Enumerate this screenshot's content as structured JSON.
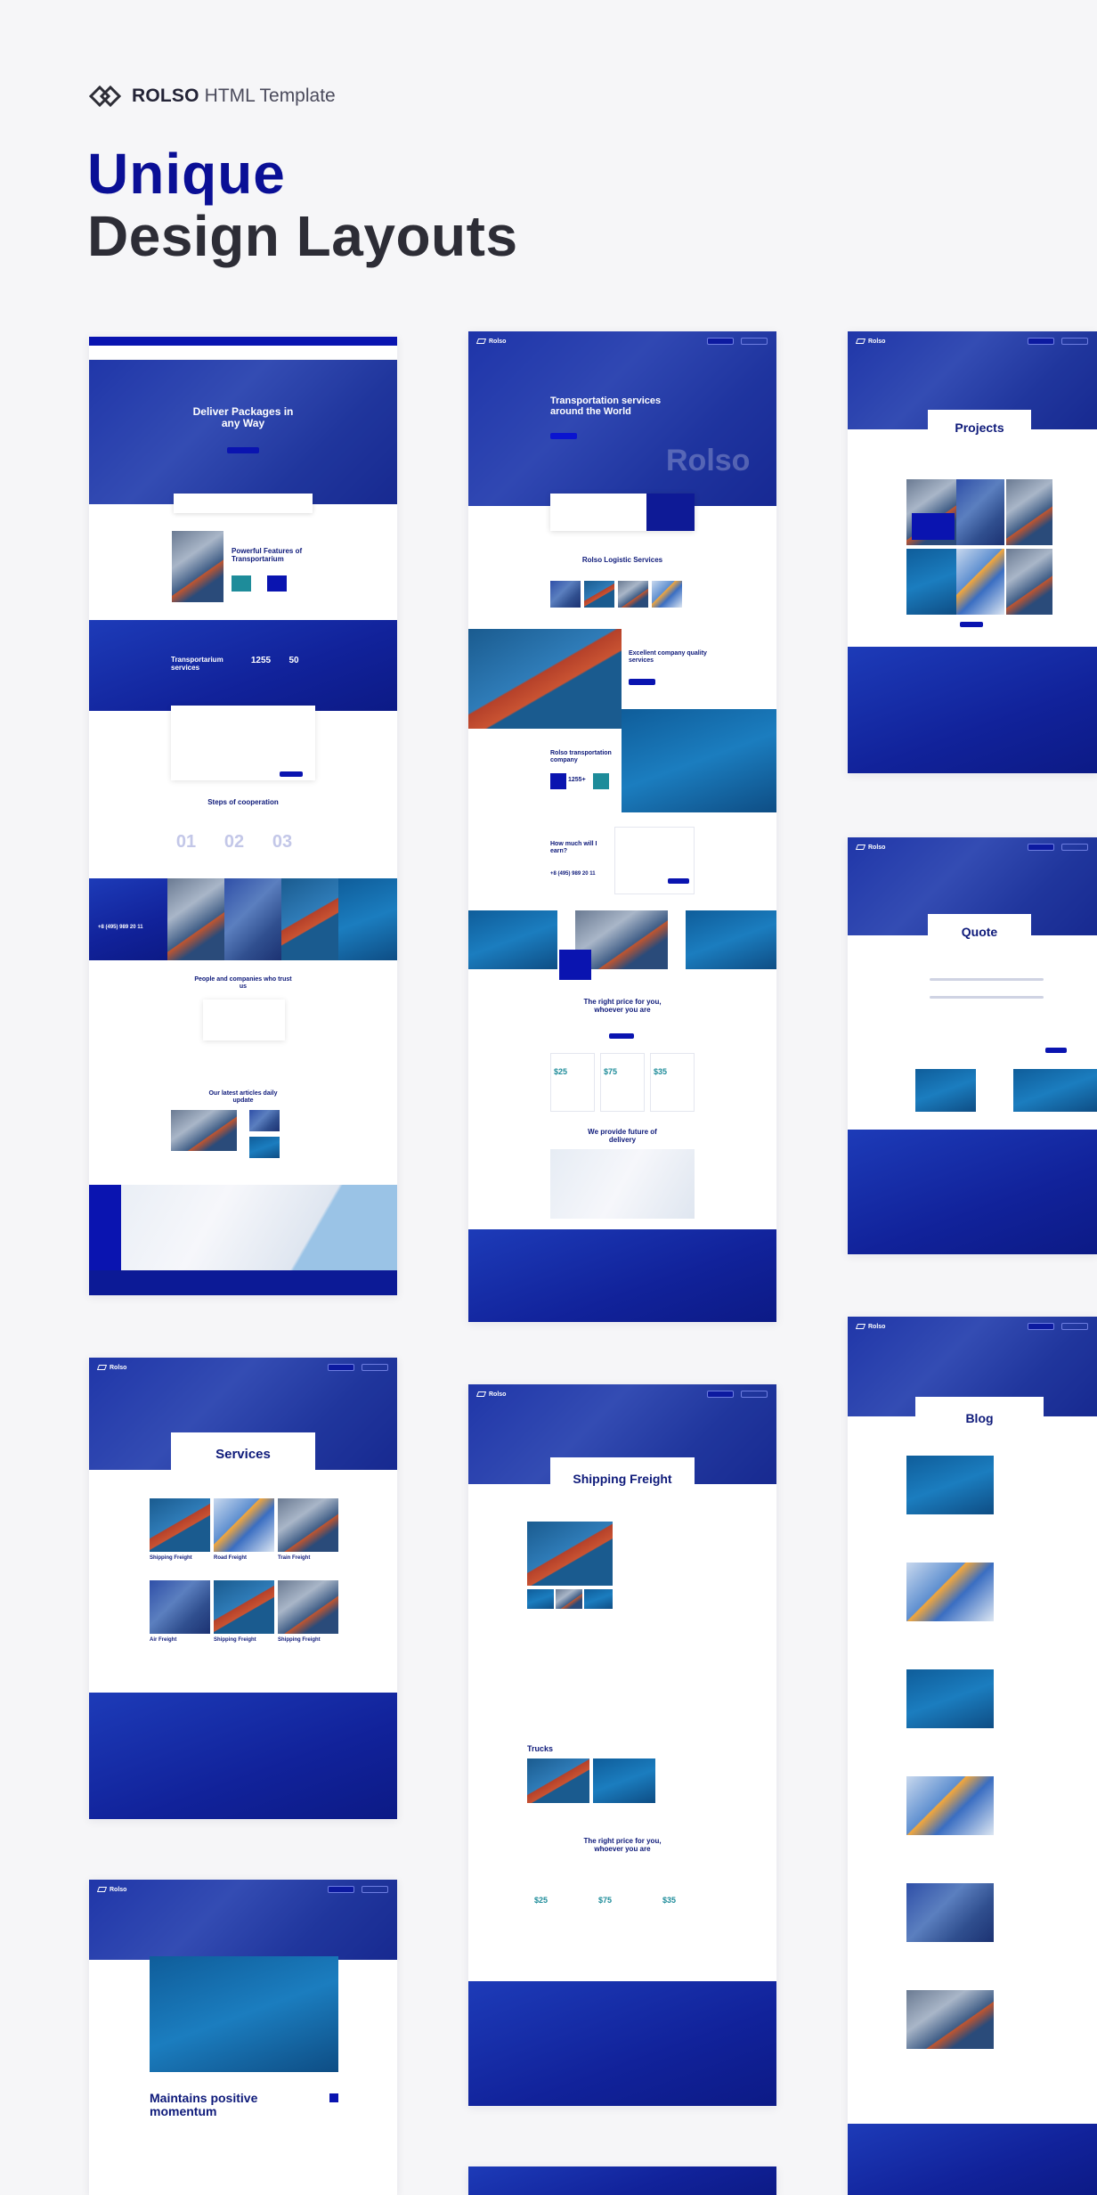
{
  "header": {
    "brand": "ROLSO",
    "brand_sub": "HTML Template",
    "title_line1": "Unique",
    "title_line2": "Design Layouts"
  },
  "colors": {
    "accent": "#0a0f96",
    "dark": "#2d2d36",
    "brand_blue": "#11229a"
  },
  "home": {
    "hero": "Deliver Packages in any Way",
    "features": "Powerful Features of Transportarium",
    "stats_title": "Transportarium services",
    "stat1": "1255",
    "stat2": "50",
    "steps_title": "Steps of cooperation",
    "steps": [
      "01",
      "02",
      "03"
    ],
    "phone": "+8 (495) 989 20 11",
    "trust": "People and companies who trust us",
    "articles": "Our latest articles daily update"
  },
  "home2": {
    "hero": "Transportation services around the World",
    "logistic": "Rolso Logistic Services",
    "quality": "Excellent company quality services",
    "transport": "Rolso transportation company",
    "stat": "1255+",
    "calc": "How much will I earn?",
    "phone": "+8 (495) 989 20 11",
    "price_title": "The right price for you, whoever you are",
    "prices": [
      "$25",
      "$75",
      "$35"
    ],
    "future": "We provide future of delivery",
    "watermark": "Rolso"
  },
  "projects": {
    "title": "Projects"
  },
  "quote": {
    "title": "Quote"
  },
  "services": {
    "title": "Services",
    "items": [
      "Shipping Freight",
      "Road Freight",
      "Train Freight",
      "Air Freight",
      "Shipping Freight",
      "Shipping Freight"
    ]
  },
  "freight": {
    "title": "Shipping Freight",
    "trucks": "Trucks",
    "price_title": "The right price for you, whoever you are",
    "prices": [
      "$25",
      "$75",
      "$35"
    ]
  },
  "blog": {
    "title": "Blog"
  },
  "post": {
    "title": "Maintains positive momentum"
  }
}
